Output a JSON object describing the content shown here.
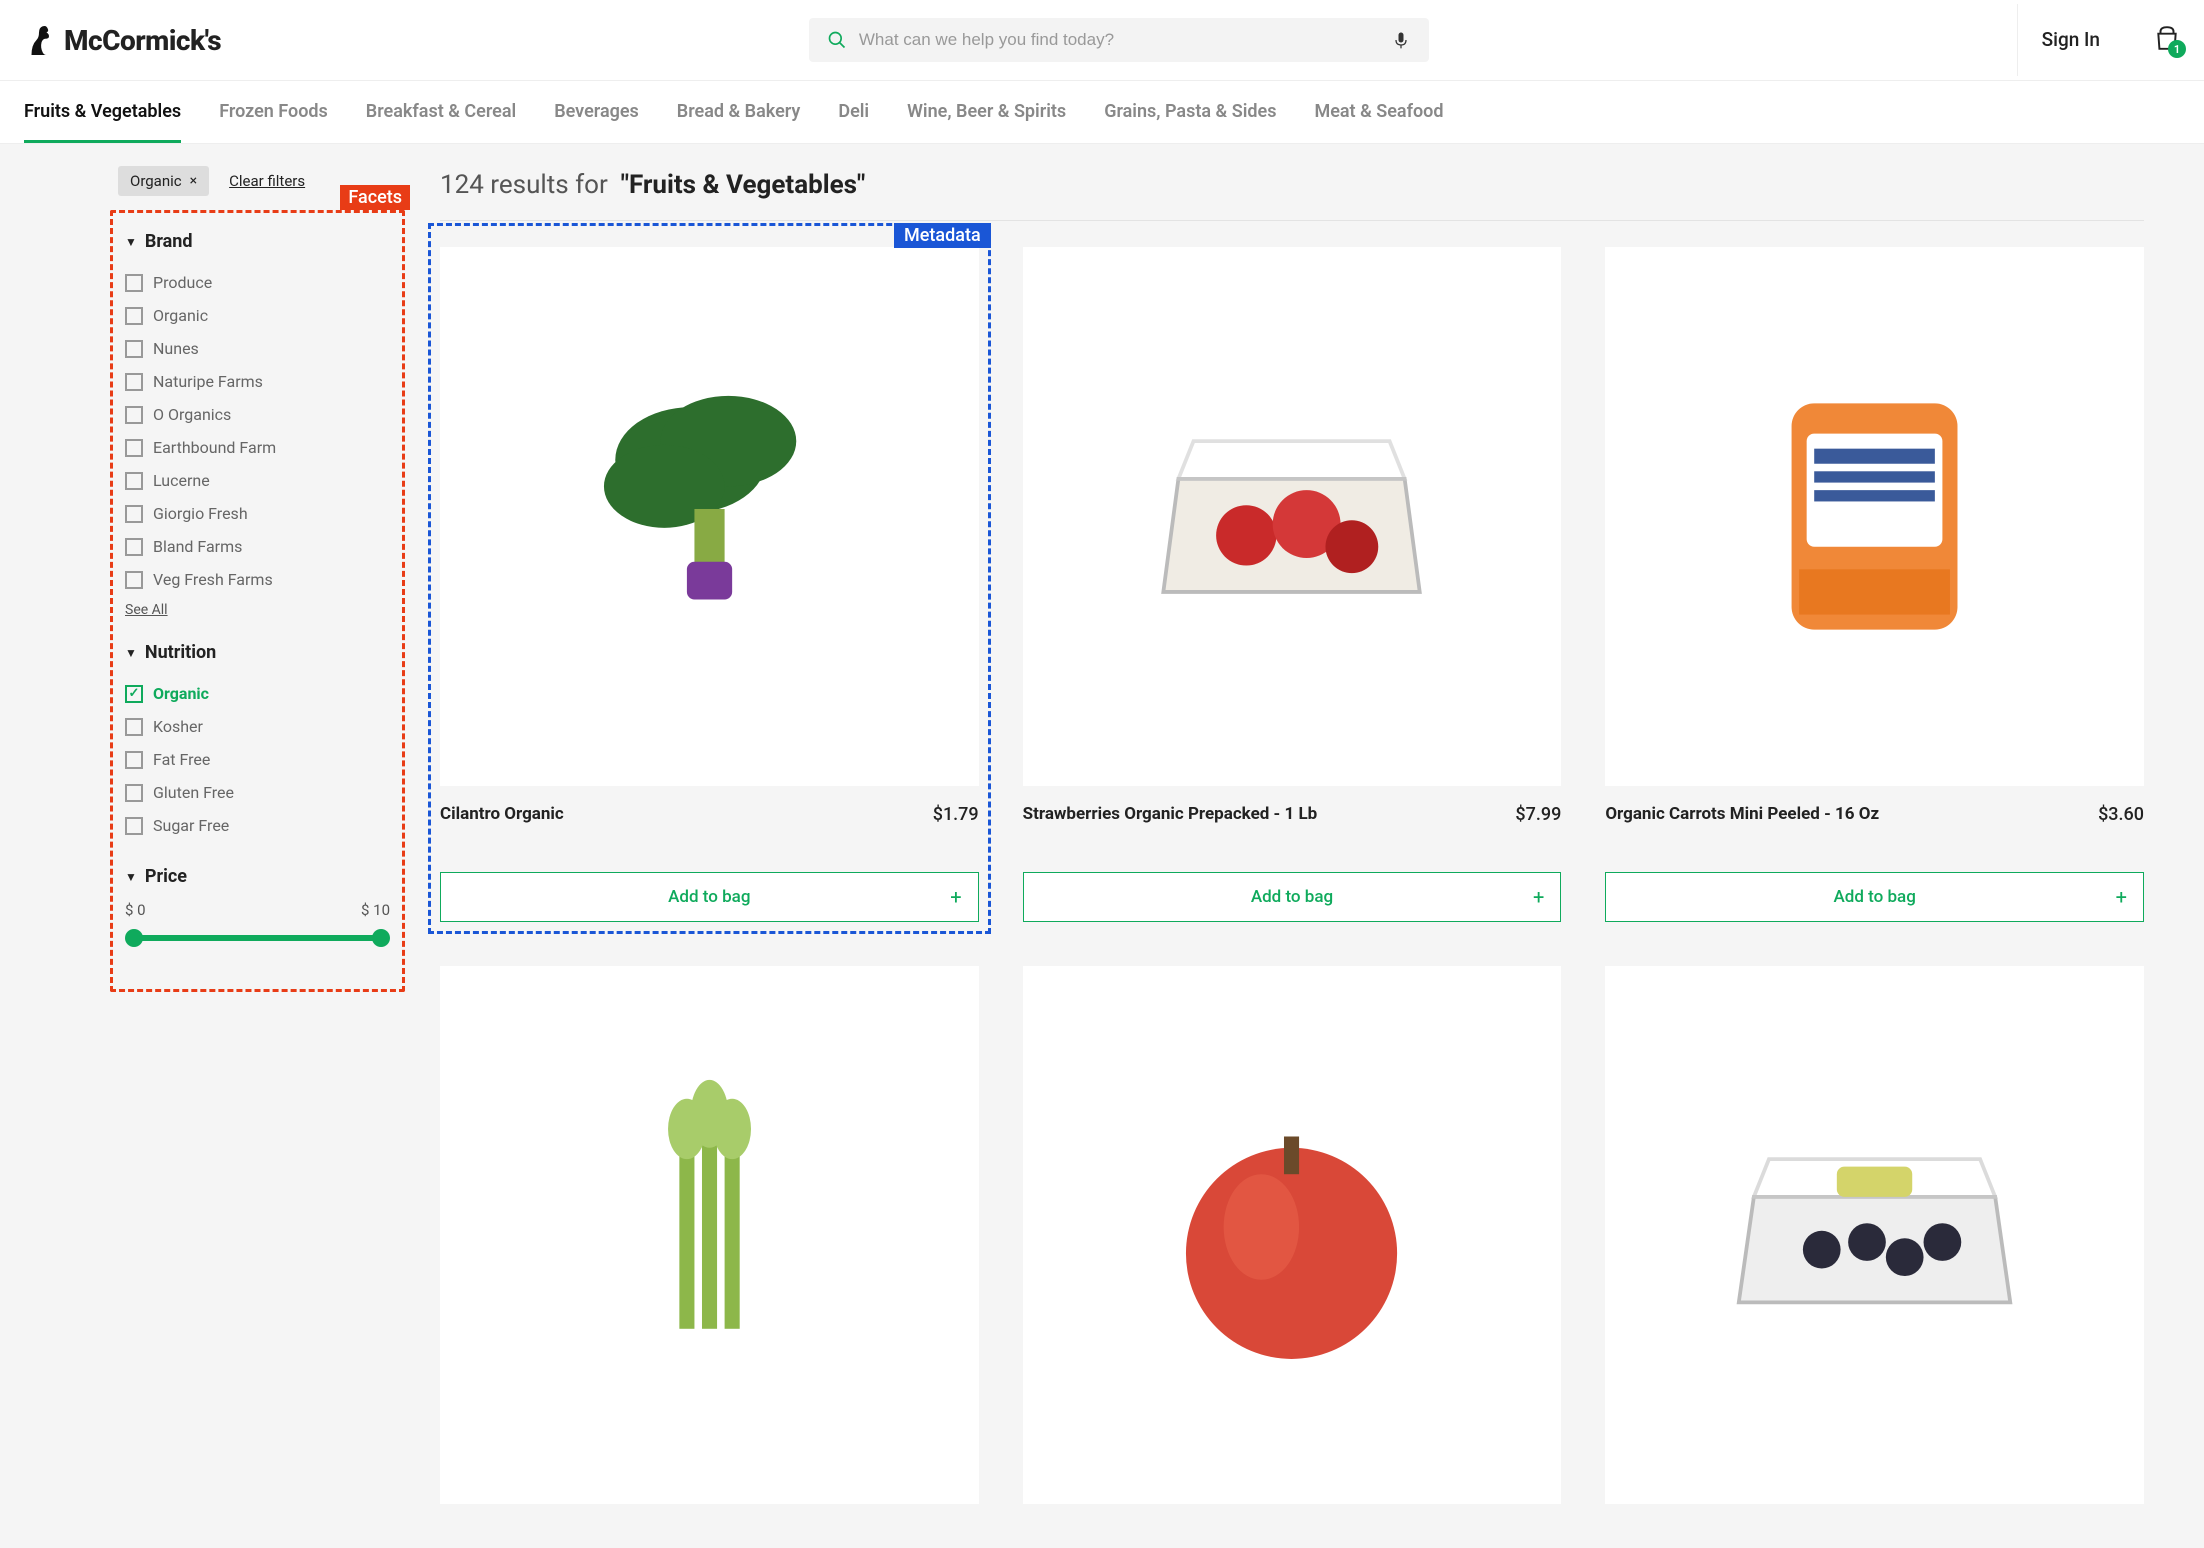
{
  "header": {
    "brand": "McCormick's",
    "search_placeholder": "What can we help you find today?",
    "sign_in": "Sign In",
    "cart_count": "1"
  },
  "nav": [
    {
      "label": "Fruits & Vegetables",
      "active": true
    },
    {
      "label": "Frozen Foods",
      "active": false
    },
    {
      "label": "Breakfast & Cereal",
      "active": false
    },
    {
      "label": "Beverages",
      "active": false
    },
    {
      "label": "Bread & Bakery",
      "active": false
    },
    {
      "label": "Deli",
      "active": false
    },
    {
      "label": "Wine, Beer & Spirits",
      "active": false
    },
    {
      "label": "Grains, Pasta & Sides",
      "active": false
    },
    {
      "label": "Meat & Seafood",
      "active": false
    }
  ],
  "filters": {
    "chip_label": "Organic",
    "clear_label": "Clear filters"
  },
  "annot": {
    "facets": "Facets",
    "metadata": "Metadata"
  },
  "facets": {
    "brand": {
      "title": "Brand",
      "options": [
        "Produce",
        "Organic",
        "Nunes",
        "Naturipe Farms",
        "O Organics",
        "Earthbound Farm",
        "Lucerne",
        "Giorgio Fresh",
        "Bland Farms",
        "Veg Fresh Farms"
      ],
      "see_all": "See All"
    },
    "nutrition": {
      "title": "Nutrition",
      "options": [
        {
          "label": "Organic",
          "checked": true
        },
        {
          "label": "Kosher",
          "checked": false
        },
        {
          "label": "Fat Free",
          "checked": false
        },
        {
          "label": "Gluten Free",
          "checked": false
        },
        {
          "label": "Sugar Free",
          "checked": false
        }
      ]
    },
    "price": {
      "title": "Price",
      "min": "$ 0",
      "max": "$ 10"
    }
  },
  "results": {
    "count": "124",
    "label_prefix": "results for",
    "query": "\"Fruits & Vegetables\"",
    "add_label": "Add to bag",
    "items": [
      {
        "name": "Cilantro Organic",
        "price": "$1.79",
        "annotated": true
      },
      {
        "name": "Strawberries Organic Prepacked - 1 Lb",
        "price": "$7.99"
      },
      {
        "name": "Organic Carrots Mini Peeled - 16 Oz",
        "price": "$3.60"
      },
      {
        "name": "",
        "price": ""
      },
      {
        "name": "",
        "price": ""
      },
      {
        "name": "",
        "price": ""
      }
    ]
  }
}
